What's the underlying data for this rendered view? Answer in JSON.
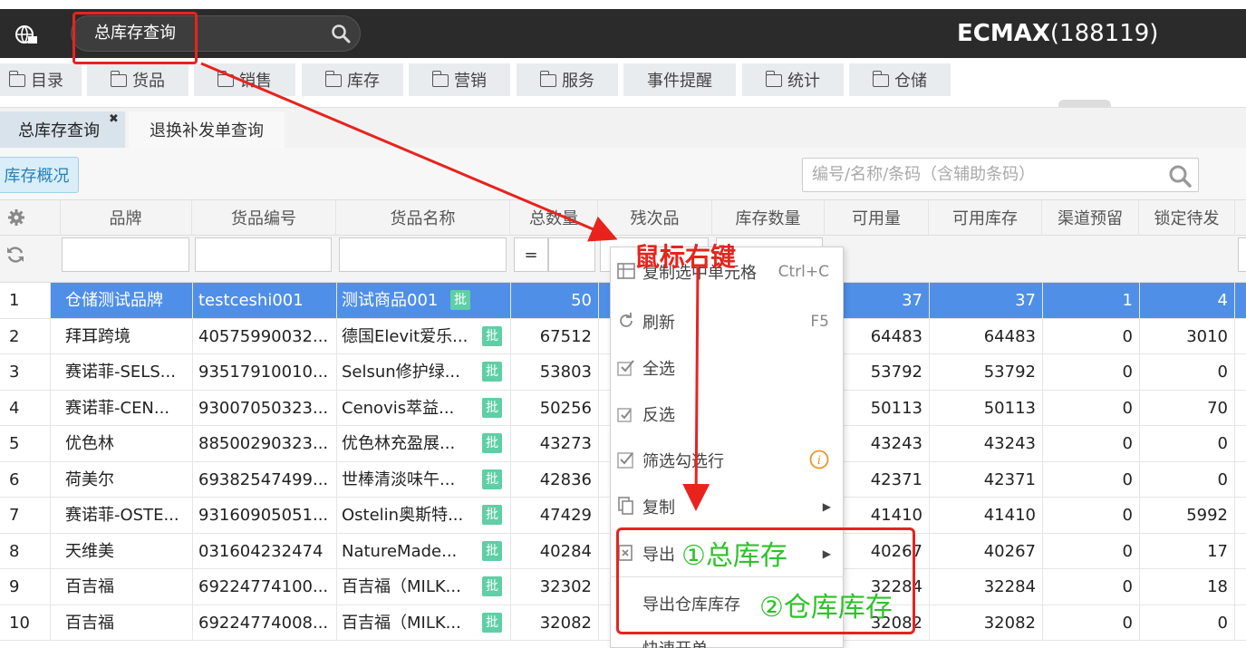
{
  "topbar": {
    "search_text": "总库存查询",
    "brand": "ECMAX",
    "brand_suffix": "(188119)"
  },
  "menu": [
    {
      "label": "目录",
      "folder": true
    },
    {
      "label": "货品",
      "folder": true
    },
    {
      "label": "销售",
      "folder": true
    },
    {
      "label": "库存",
      "folder": true
    },
    {
      "label": "营销",
      "folder": true
    },
    {
      "label": "服务",
      "folder": true
    },
    {
      "label": "事件提醒",
      "folder": false
    },
    {
      "label": "统计",
      "folder": true
    },
    {
      "label": "仓储",
      "folder": true
    }
  ],
  "tabs": [
    {
      "label": "总库存查询",
      "close": "✖"
    },
    {
      "label": "退换补发单查询"
    }
  ],
  "toolbar": {
    "overview_label": "库存概况",
    "filter_placeholder": "编号/名称/条码（含辅助条码）"
  },
  "table": {
    "columns": [
      "品牌",
      "货品编号",
      "货品名称",
      "总数量",
      "残次品",
      "库存数量",
      "可用量",
      "可用库存",
      "渠道预留",
      "锁定待发"
    ],
    "filter_op": "=",
    "badge": "批",
    "rows": [
      {
        "n": "1",
        "brand": "仓储测试品牌",
        "code": "testceshi001",
        "name": "测试商品001",
        "total": "50",
        "avail": "37",
        "avail_stock": "37",
        "reserve": "1",
        "locked": "4"
      },
      {
        "n": "2",
        "brand": "拜耳跨境",
        "code": "40575990032...",
        "name": "德国Elevit爱乐...",
        "total": "67512",
        "avail": "64483",
        "avail_stock": "64483",
        "reserve": "0",
        "locked": "3010"
      },
      {
        "n": "3",
        "brand": "赛诺菲-SELS...",
        "code": "93517910010...",
        "name": "Selsun修护绿...",
        "total": "53803",
        "avail": "53792",
        "avail_stock": "53792",
        "reserve": "0",
        "locked": "0"
      },
      {
        "n": "4",
        "brand": "赛诺菲-CEN...",
        "code": "93007050323...",
        "name": "Cenovis萃益...",
        "total": "50256",
        "avail": "50113",
        "avail_stock": "50113",
        "reserve": "0",
        "locked": "70"
      },
      {
        "n": "5",
        "brand": "优色林",
        "code": "88500290323...",
        "name": "优色林充盈展...",
        "total": "43273",
        "avail": "43243",
        "avail_stock": "43243",
        "reserve": "0",
        "locked": "0"
      },
      {
        "n": "6",
        "brand": "荷美尔",
        "code": "69382547499...",
        "name": "世棒清淡味午...",
        "total": "42836",
        "avail": "42371",
        "avail_stock": "42371",
        "reserve": "0",
        "locked": "0"
      },
      {
        "n": "7",
        "brand": "赛诺菲-OSTE...",
        "code": "93160905051...",
        "name": "Ostelin奥斯特...",
        "total": "47429",
        "avail": "41410",
        "avail_stock": "41410",
        "reserve": "0",
        "locked": "5992"
      },
      {
        "n": "8",
        "brand": "天维美",
        "code": "031604232474",
        "name": "NatureMade...",
        "total": "40284",
        "avail": "40267",
        "avail_stock": "40267",
        "reserve": "0",
        "locked": "17"
      },
      {
        "n": "9",
        "brand": "百吉福",
        "code": "69224774100...",
        "name": "百吉福（MILK...",
        "total": "32302",
        "avail": "32284",
        "avail_stock": "32284",
        "reserve": "0",
        "locked": "18"
      },
      {
        "n": "10",
        "brand": "百吉福",
        "code": "69224774008...",
        "name": "百吉福（MILK...",
        "total": "32082",
        "avail": "32082",
        "avail_stock": "32082",
        "reserve": "0",
        "locked": "0"
      }
    ]
  },
  "context_menu": {
    "copy_cells": "复制选中单元格",
    "copy_cells_shortcut": "Ctrl+C",
    "refresh": "刷新",
    "refresh_shortcut": "F5",
    "select_all": "全选",
    "invert": "反选",
    "filter_checked": "筛选勾选行",
    "copy": "复制",
    "export": "导出",
    "export_warehouse": "导出仓库库存",
    "more": "快速开单"
  },
  "annotations": {
    "right_click": "鼠标右键",
    "step1": "①总库存",
    "step2": "②仓库库存"
  },
  "colors": {
    "accent": "#4f8fe8",
    "annotation_red": "#e8231e",
    "annotation_green": "#2ec22a",
    "badge": "#5fcfa5"
  }
}
